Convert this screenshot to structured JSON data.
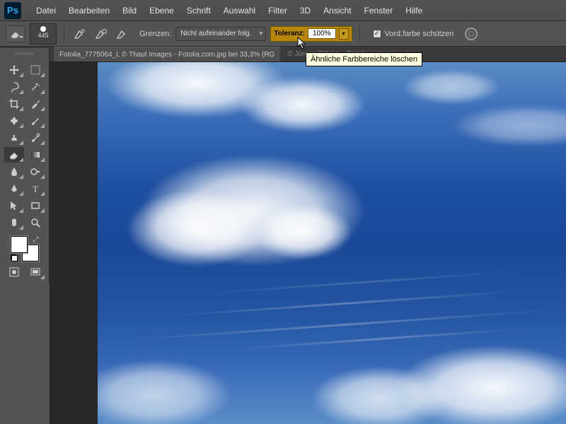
{
  "app": {
    "logo_text": "Ps"
  },
  "menu": {
    "items": [
      "Datei",
      "Bearbeiten",
      "Bild",
      "Ebene",
      "Schrift",
      "Auswahl",
      "Filter",
      "3D",
      "Ansicht",
      "Fenster",
      "Hilfe"
    ]
  },
  "options": {
    "brush_size": "445",
    "limits_label": "Grenzen:",
    "limits_value": "Nicht aufeinander folg.",
    "tolerance_label": "Toleranz:",
    "tolerance_value": "100%",
    "protect_fg_label": "Vord.farbe schützen",
    "protect_fg_checked": "✓"
  },
  "tooltip": {
    "text": "Ähnliche Farbbereiche löschen"
  },
  "tabs": {
    "active": "Fotolia_7775064_L © Thaut Images - Fotolia.com.jpg bei 33,3% (RG",
    "inactive": "© Jürgen Fälchle - Fotolia.com.jpg"
  },
  "colors": {
    "accent": "#b8860b",
    "tooltip_bg": "#ffffe1",
    "ui_bg": "#535353",
    "canvas_bg": "#282828"
  }
}
